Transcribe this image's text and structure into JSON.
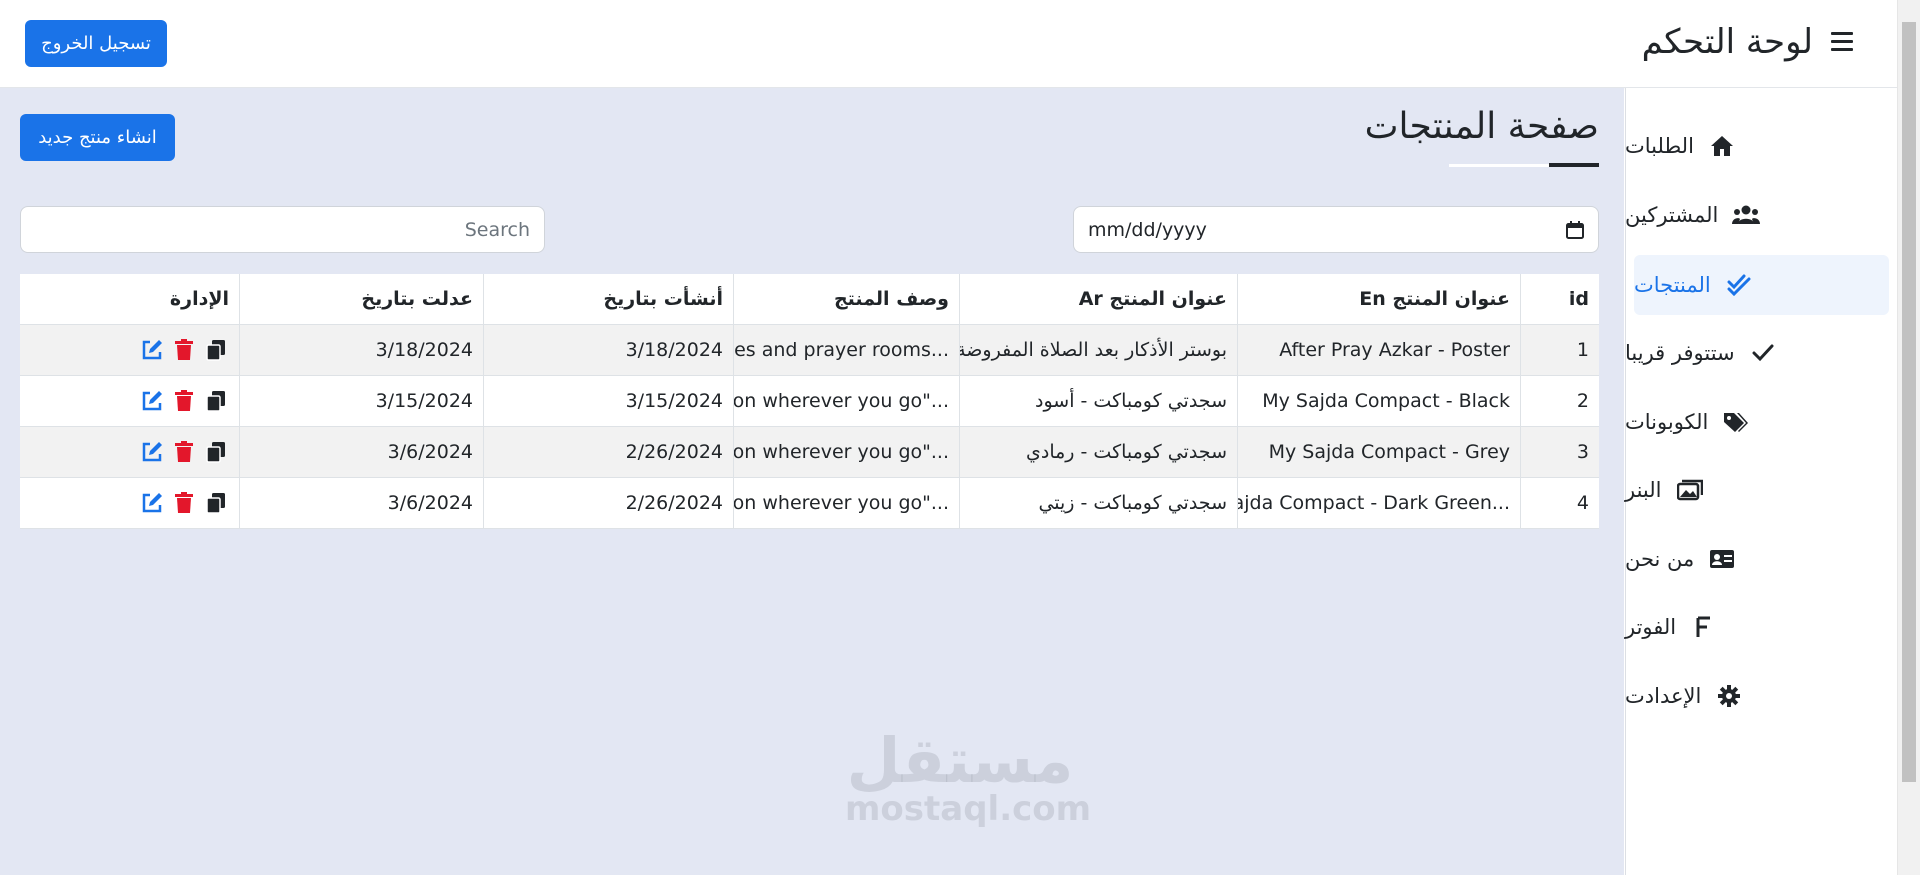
{
  "header": {
    "app_title": "لوحة التحكم",
    "logout_label": "تسجيل الخروج",
    "menu_icon": "hamburger-icon"
  },
  "sidebar": {
    "items": [
      {
        "label": "الطلبات",
        "icon": "home-icon",
        "active": false
      },
      {
        "label": "المشتركين",
        "icon": "users-icon",
        "active": false
      },
      {
        "label": "المنتجات",
        "icon": "double-check-icon",
        "active": true
      },
      {
        "label": "ستتوفر قريبا",
        "icon": "check-icon",
        "active": false
      },
      {
        "label": "الكوبونات",
        "icon": "tags-icon",
        "active": false
      },
      {
        "label": "البنر",
        "icon": "images-icon",
        "active": false
      },
      {
        "label": "من نحن",
        "icon": "id-card-icon",
        "active": false
      },
      {
        "label": "الفوتر",
        "icon": "letter-f-icon",
        "active": false
      },
      {
        "label": "الإعدادت",
        "icon": "gear-icon",
        "active": false
      }
    ],
    "active_color": "#1a73e8"
  },
  "main": {
    "page_title": "صفحة المنتجات",
    "create_label": "انشاء منتج جديد",
    "search_placeholder": "Search",
    "date_value": "mm/dd/yyyy"
  },
  "table": {
    "headers": {
      "id": "id",
      "title_en": "عنوان المنتج En",
      "title_ar": "عنوان المنتج Ar",
      "description": "وصف المنتج",
      "created": "أنشأت بتاريخ",
      "updated": "عدلت بتاريخ",
      "actions": "الإدارة"
    },
    "rows": [
      {
        "id": "1",
        "title_en": "After Pray Azkar - Poster",
        "title_ar": "بوستر الأذكار بعد الصلاة المفروضة",
        "description": "es and prayer rooms...",
        "created": "3/18/2024",
        "updated": "3/18/2024"
      },
      {
        "id": "2",
        "title_en": "My Sajda Compact - Black",
        "title_ar": "سجدتي كومباكت - أسود",
        "description": "ion wherever you go\"...",
        "created": "3/15/2024",
        "updated": "3/15/2024"
      },
      {
        "id": "3",
        "title_en": "My Sajda Compact - Grey",
        "title_ar": "سجدتي كومباكت - رمادي",
        "description": "ion wherever you go\"...",
        "created": "2/26/2024",
        "updated": "3/6/2024"
      },
      {
        "id": "4",
        "title_en": "ajda Compact - Dark Green...",
        "title_ar": "سجدتي كومباكت - زيتي",
        "description": "ion wherever you go\"...",
        "created": "2/26/2024",
        "updated": "3/6/2024"
      }
    ],
    "action_icons": [
      "edit-icon",
      "trash-icon",
      "copy-icon"
    ]
  },
  "watermark": {
    "ar": "مستقل",
    "en": "mostaql.com"
  },
  "colors": {
    "primary": "#1a73e8",
    "danger": "#e3172b",
    "main_bg": "#e3e7f3"
  }
}
